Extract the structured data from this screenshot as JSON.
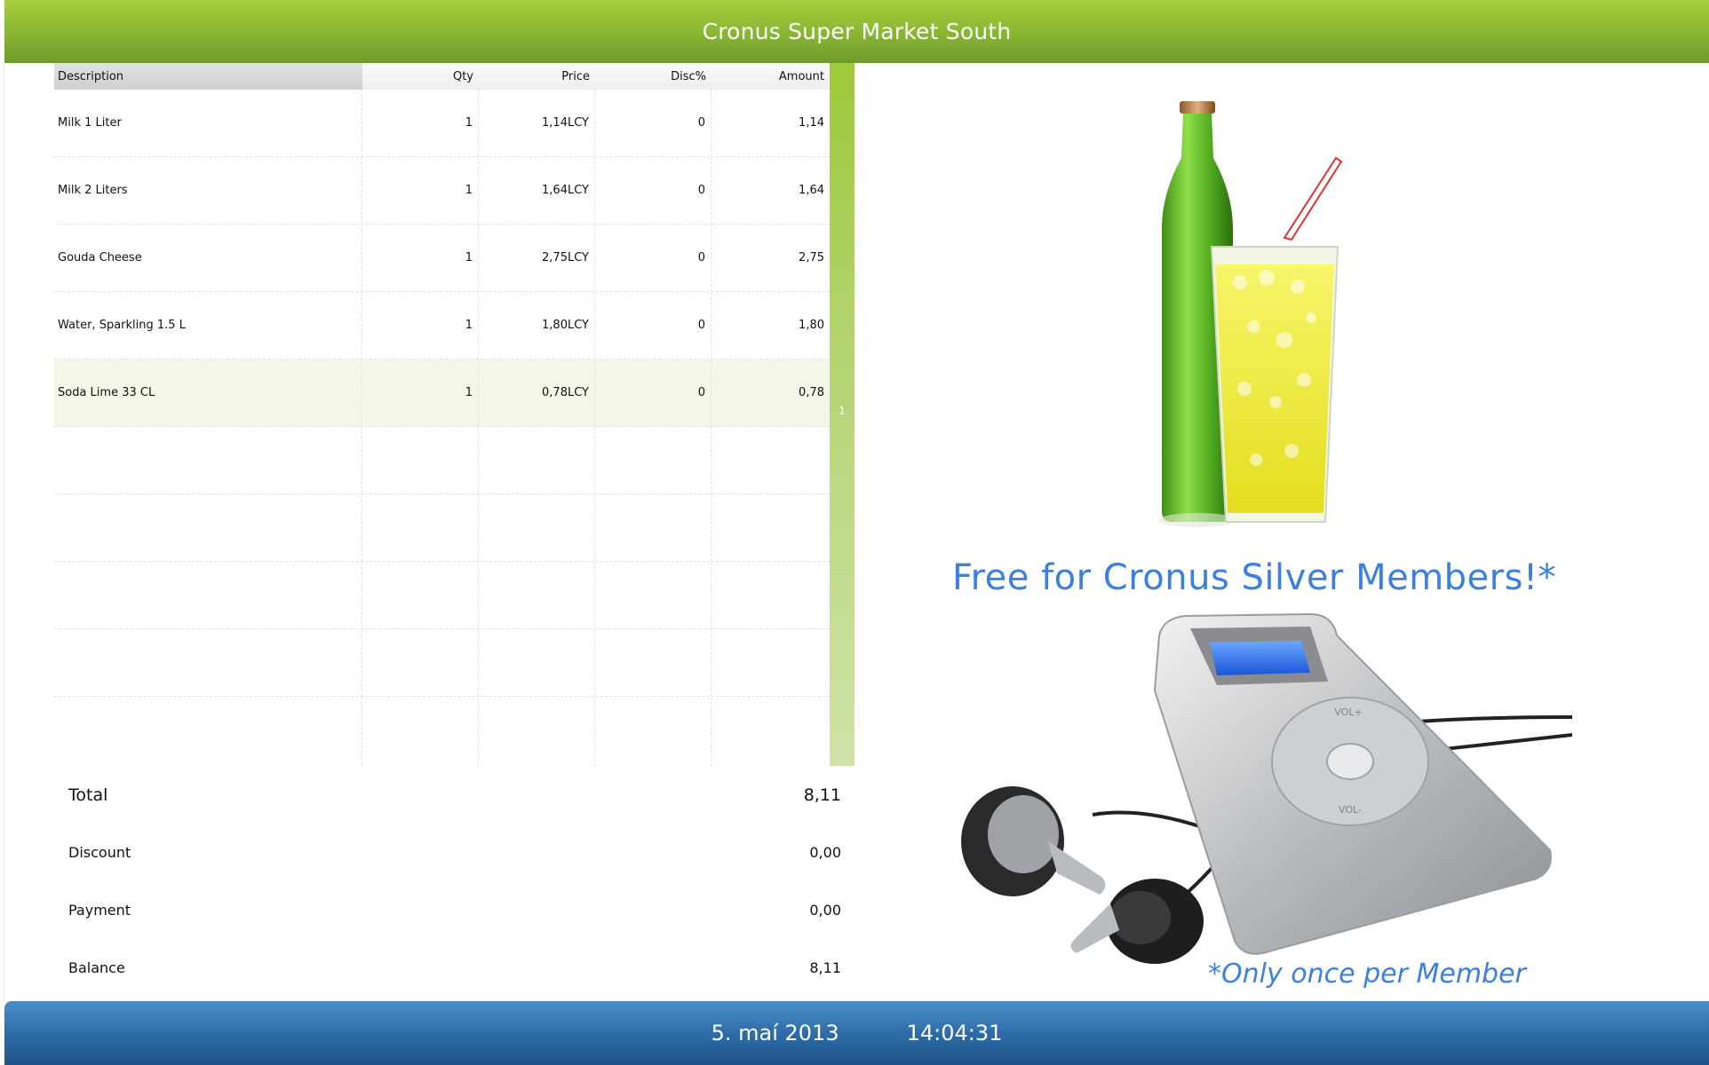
{
  "header": {
    "title": "Cronus Super Market South"
  },
  "grid": {
    "columns": [
      "Description",
      "Qty",
      "Price",
      "Disc%",
      "Amount"
    ],
    "rows": [
      {
        "description": "Milk 1 Liter",
        "qty": "1",
        "price": "1,14LCY",
        "disc": "0",
        "amount": "1,14"
      },
      {
        "description": "Milk 2 Liters",
        "qty": "1",
        "price": "1,64LCY",
        "disc": "0",
        "amount": "1,64"
      },
      {
        "description": "Gouda Cheese",
        "qty": "1",
        "price": "2,75LCY",
        "disc": "0",
        "amount": "2,75"
      },
      {
        "description": "Water, Sparkling 1.5 L",
        "qty": "1",
        "price": "1,80LCY",
        "disc": "0",
        "amount": "1,80"
      },
      {
        "description": "Soda Lime 33 CL",
        "qty": "1",
        "price": "0,78LCY",
        "disc": "0",
        "amount": "0,78"
      }
    ],
    "selected_row": 4,
    "scroll_label": "1"
  },
  "totals": {
    "total_label": "Total",
    "total_value": "8,11",
    "discount_label": "Discount",
    "discount_value": "0,00",
    "payment_label": "Payment",
    "payment_value": "0,00",
    "balance_label": "Balance",
    "balance_value": "8,11"
  },
  "ad": {
    "headline": "Free for Cronus Silver Members!*",
    "footnote": "*Only once per Member",
    "player_labels": {
      "vol_top": "VOL+",
      "vol_bottom": "VOL-"
    }
  },
  "footer": {
    "date": "5. maí 2013",
    "time": "14:04:31"
  },
  "colors": {
    "header_green": "#8ab834",
    "footer_blue": "#2e6da8",
    "ad_text": "#3b7fe0",
    "selected_row": "#f2f7e7"
  }
}
